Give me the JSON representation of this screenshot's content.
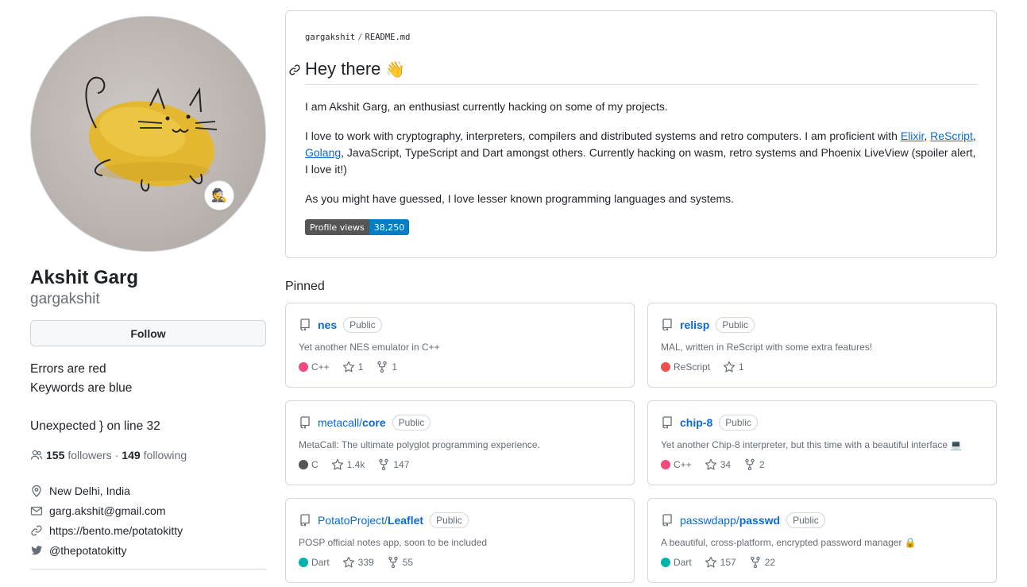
{
  "profile": {
    "name": "Akshit Garg",
    "login": "gargakshit",
    "follow_label": "Follow",
    "status_emoji": "🕵",
    "bio_lines": [
      "Errors are red",
      "Keywords are blue",
      "Unexpected } on line 32"
    ],
    "followers_count": "155",
    "followers_label": "followers",
    "dot": "·",
    "following_count": "149",
    "following_label": "following",
    "location": "New Delhi, India",
    "email": "garg.akshit@gmail.com",
    "website": "https://bento.me/potatokitty",
    "twitter": "@thepotatokitty"
  },
  "readme": {
    "owner": "gargakshit",
    "slash": "/",
    "file": "README.md",
    "heading": "Hey there",
    "heading_emoji": "👋",
    "p1": "I am Akshit Garg, an enthusiast currently hacking on some of my projects.",
    "p2_start": "I love to work with cryptography, interpreters, compilers and distributed systems and retro computers. I am proficient with ",
    "p2_link1": "Elixir",
    "p2_comma1": ", ",
    "p2_link2": "ReScript",
    "p2_comma2": ", ",
    "p2_link3": "Golang",
    "p2_end": ", JavaScript, TypeScript and Dart amongst others. Currently hacking on wasm, retro systems and Phoenix LiveView (spoiler alert, I love it!)",
    "p3": "As you might have guessed, I love lesser known programming languages and systems.",
    "badge_label": "Profile views",
    "badge_value": "38,250"
  },
  "pinned": {
    "title": "Pinned",
    "public_label": "Public",
    "repos": [
      {
        "owner": "",
        "name": "nes",
        "desc": "Yet another NES emulator in C++",
        "lang": "C++",
        "lang_color": "#f34b7d",
        "stars": "1",
        "forks": "1"
      },
      {
        "owner": "",
        "name": "relisp",
        "desc": "MAL, written in ReScript with some extra features!",
        "lang": "ReScript",
        "lang_color": "#ed5051",
        "stars": "1",
        "forks": ""
      },
      {
        "owner": "metacall/",
        "name": "core",
        "desc": "MetaCall: The ultimate polyglot programming experience.",
        "lang": "C",
        "lang_color": "#555555",
        "stars": "1.4k",
        "forks": "147"
      },
      {
        "owner": "",
        "name": "chip-8",
        "desc": "Yet another Chip-8 interpreter, but this time with a beautiful interface 💻",
        "lang": "C++",
        "lang_color": "#f34b7d",
        "stars": "34",
        "forks": "2"
      },
      {
        "owner": "PotatoProject/",
        "name": "Leaflet",
        "desc": "POSP official notes app, soon to be included",
        "lang": "Dart",
        "lang_color": "#00b4ab",
        "stars": "339",
        "forks": "55"
      },
      {
        "owner": "passwdapp/",
        "name": "passwd",
        "desc": "A beautiful, cross-platform, encrypted password manager 🔒",
        "lang": "Dart",
        "lang_color": "#00b4ab",
        "stars": "157",
        "forks": "22"
      }
    ]
  }
}
